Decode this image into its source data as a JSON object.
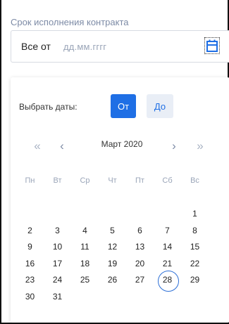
{
  "field": {
    "label": "Срок исполнения контракта",
    "prefix": "Все от",
    "placeholder": "дд.мм.гггг"
  },
  "picker": {
    "select_label": "Выбрать даты:",
    "from_label": "От",
    "to_label": "До",
    "nav": {
      "prev_year": "«",
      "prev_month": "‹",
      "next_month": "›",
      "next_year": "»"
    },
    "month_title": "Март 2020",
    "weekdays": [
      "Пн",
      "Вт",
      "Ср",
      "Чт",
      "Пт",
      "Сб",
      "Вс"
    ],
    "weeks": [
      [
        "",
        "",
        "",
        "",
        "",
        "",
        "1"
      ],
      [
        "2",
        "3",
        "4",
        "5",
        "6",
        "7",
        "8"
      ],
      [
        "9",
        "10",
        "11",
        "12",
        "13",
        "14",
        "15"
      ],
      [
        "16",
        "17",
        "18",
        "19",
        "20",
        "21",
        "22"
      ],
      [
        "23",
        "24",
        "25",
        "26",
        "27",
        "28",
        "29"
      ],
      [
        "30",
        "31",
        "",
        "",
        "",
        "",
        ""
      ]
    ],
    "today": "28"
  },
  "colors": {
    "accent": "#1f6fe5",
    "muted": "#9aa5b8"
  }
}
